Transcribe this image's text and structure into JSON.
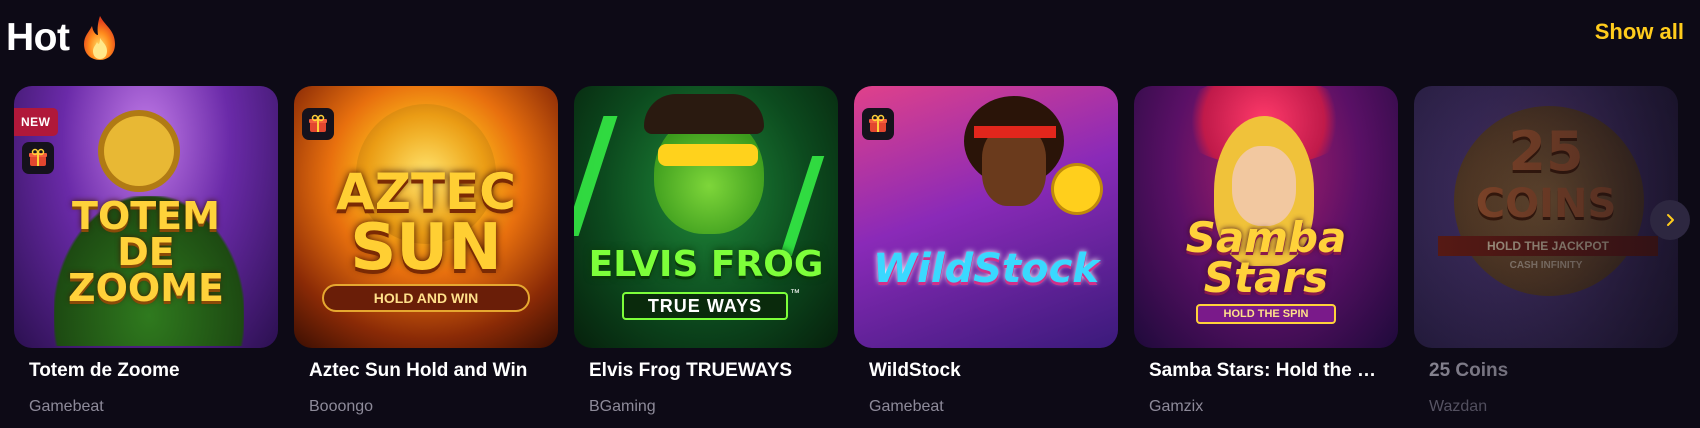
{
  "section": {
    "title": "Hot",
    "title_icon": "fire-icon",
    "show_all_label": "Show all"
  },
  "games": [
    {
      "name": "Totem de Zoome",
      "provider": "Gamebeat",
      "badge": "NEW",
      "has_gift": true,
      "art_text": [
        "TOTEM",
        "DE",
        "ZOOME"
      ]
    },
    {
      "name": "Aztec Sun Hold and Win",
      "provider": "Booongo",
      "has_gift": true,
      "art_text": [
        "AZTEC",
        "SUN",
        "HOLD AND WIN"
      ]
    },
    {
      "name": "Elvis Frog TRUEWAYS",
      "provider": "BGaming",
      "has_gift": false,
      "art_text": [
        "ELVIS FROG",
        "TRUE WAYS",
        "™"
      ]
    },
    {
      "name": "WildStock",
      "provider": "Gamebeat",
      "has_gift": true,
      "art_text": [
        "WildStock"
      ]
    },
    {
      "name": "Samba Stars: Hold the …",
      "provider": "Gamzix",
      "has_gift": false,
      "art_text": [
        "Samba",
        "Stars",
        "HOLD THE SPIN"
      ]
    },
    {
      "name": "25 Coins",
      "provider": "Wazdan",
      "has_gift": false,
      "art_text": [
        "25",
        "COINS",
        "HOLD THE JACKPOT",
        "CASH INFINITY"
      ]
    }
  ],
  "colors": {
    "background": "#0d0a16",
    "accent": "#ffcc1c",
    "badge_new": "#b0183a",
    "provider_text": "#8d8a99"
  },
  "carousel": {
    "next_icon": "chevron-right-icon"
  }
}
